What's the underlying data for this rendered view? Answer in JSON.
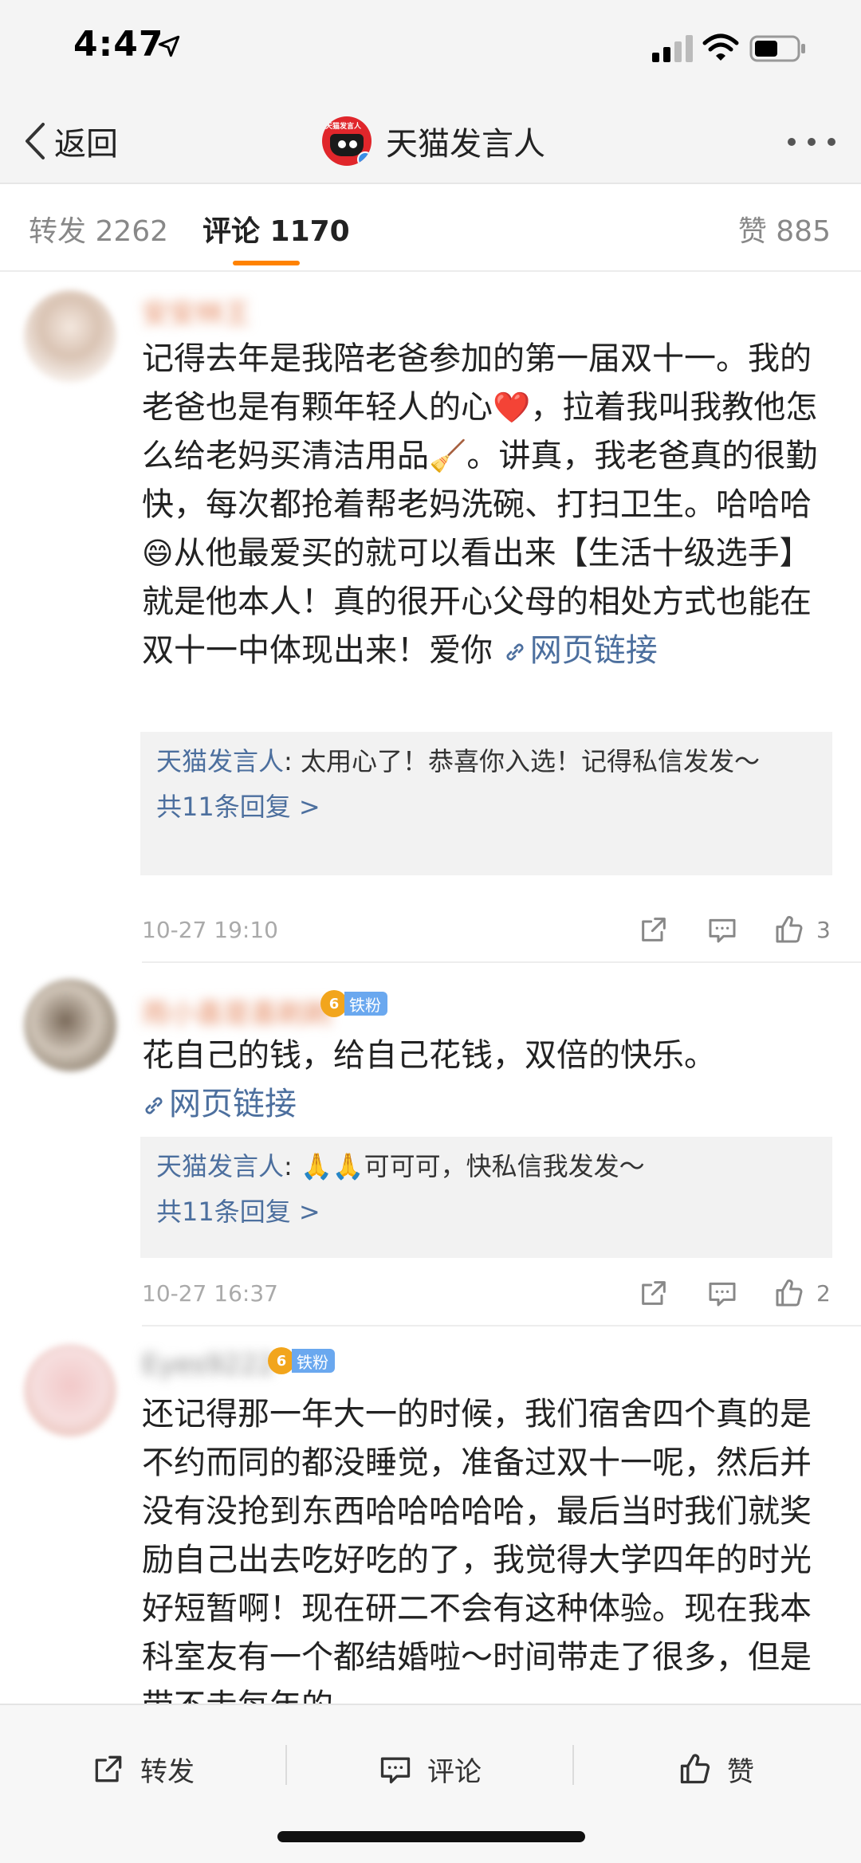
{
  "status_bar": {
    "time": "4:47"
  },
  "nav": {
    "back_label": "返回",
    "title": "天猫发言人",
    "avatar_text": "天猫发言人"
  },
  "tabs": {
    "forward": "转发 2262",
    "comment": "评论 1170",
    "like": "赞 885"
  },
  "link_label": "网页链接",
  "comments": [
    {
      "username": "安安林王",
      "text_before_heart": "记得去年是我陪老爸参加的第一届双十一。我的老爸也是有颗年轻人的心",
      "emoji_heart": "❤️",
      "text_mid1": "，拉着我叫我教他怎么给老妈买清洁用品",
      "emoji_broom": "🧹",
      "text_mid2": "。讲真，我老爸真的很勤快，每次都抢着帮老妈洗碗、打扫卫生。哈哈哈",
      "emoji_grin": "😄",
      "text_after": "从他最爱买的就可以看出来【生活十级选手】就是他本人！真的很开心父母的相处方式也能在双十一中体现出来！爱你",
      "reply_author": "天猫发言人",
      "reply_text": ": 太用心了！恭喜你入选！记得私信发发～",
      "reply_more": "共11条回复 >",
      "time": "10-27 19:10",
      "likes": "3"
    },
    {
      "username": "雨小喜是喜刷刷",
      "fan_level": "6",
      "fan_label": "铁粉",
      "text": "花自己的钱，给自己花钱，双倍的快乐。",
      "reply_author": "天猫发言人",
      "reply_emoji": "🙏🙏",
      "reply_text": "可可可，快私信我发发～",
      "reply_more": "共11条回复 >",
      "time": "10-27 16:37",
      "likes": "2"
    },
    {
      "username": "Eyes9222",
      "fan_level": "6",
      "fan_label": "铁粉",
      "text": "还记得那一年大一的时候，我们宿舍四个真的是不约而同的都没睡觉，准备过双十一呢，然后并没有没抢到东西哈哈哈哈哈，最后当时我们就奖励自己出去吃好吃的了，我觉得大学四年的时光好短暂啊！现在研二不会有这种体验。现在我本科室友有一个都结婚啦～时间带走了很多，但是带不走每年的"
    }
  ],
  "bottom_bar": {
    "forward": "转发",
    "comment": "评论",
    "like": "赞"
  },
  "colors": {
    "accent": "#ff8200",
    "link": "#4c6f9e"
  }
}
